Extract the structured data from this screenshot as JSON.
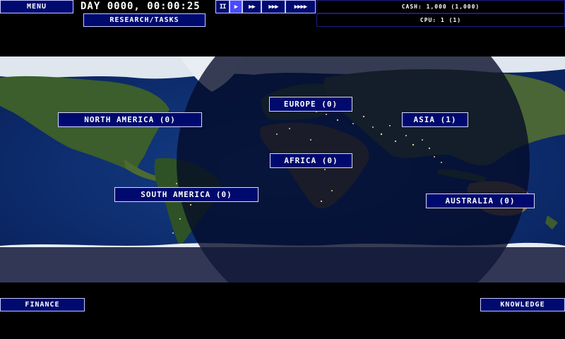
{
  "top_bar": {
    "menu_label": "MENU",
    "clock": "DAY 0000, 00:00:25",
    "research_label": "RESEARCH/TASKS",
    "cash": "CASH: 1,000 (1,000)",
    "cpu": "CPU: 1 (1)",
    "speed_buttons": [
      {
        "label": "II",
        "icon": "pause-icon",
        "active": false
      },
      {
        "label": "▶",
        "icon": "play-icon",
        "active": true
      },
      {
        "label": "▶▶",
        "icon": "fast-forward-icon",
        "active": false
      },
      {
        "label": "▶▶▶",
        "icon": "faster-forward-icon",
        "active": false
      },
      {
        "label": "▶▶▶▶",
        "icon": "fastest-forward-icon",
        "active": false
      }
    ]
  },
  "regions": {
    "north_america": "NORTH AMERICA (0)",
    "europe": "EUROPE (0)",
    "asia": "ASIA (1)",
    "africa": "AFRICA (0)",
    "south_america": "SOUTH AMERICA (0)",
    "australia": "AUSTRALIA (0)"
  },
  "bottom_bar": {
    "finance_label": "FINANCE",
    "knowledge_label": "KNOWLEDGE"
  },
  "colors": {
    "button_fill": "#000a6e",
    "button_border": "#c8c8ff",
    "active_speed": "#4a4aff",
    "ocean_day": "#0b2a6a",
    "night_overlay": "#050b2a",
    "city_lights": "#ffe89a"
  }
}
